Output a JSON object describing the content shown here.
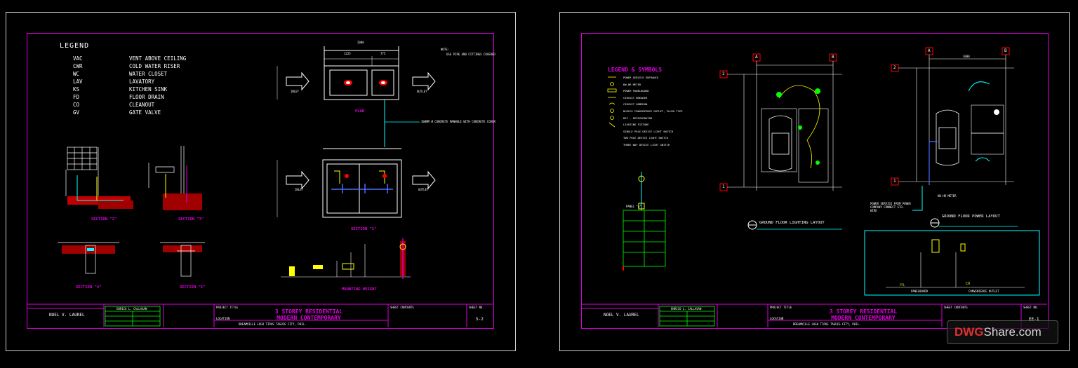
{
  "sheet_left": {
    "legend_title": "LEGEND",
    "legend": [
      {
        "code": "VAC",
        "desc": "VENT ABOVE CEILING"
      },
      {
        "code": "CWR",
        "desc": "COLD WATER RISER"
      },
      {
        "code": "WC",
        "desc": "WATER CLOSET"
      },
      {
        "code": "LAV",
        "desc": "LAVATORY"
      },
      {
        "code": "KS",
        "desc": "KITCHEN SINK"
      },
      {
        "code": "FD",
        "desc": "FLOOR DRAIN"
      },
      {
        "code": "CO",
        "desc": "CLEANOUT"
      },
      {
        "code": "GV",
        "desc": "GATE VALVE"
      }
    ],
    "labels": {
      "plan": "PLAN",
      "section_1": "SECTION \"1\"",
      "section_2": "SECTION \"2\"",
      "section_3": "SECTION \"3\"",
      "section_4": "SECTION \"4\"",
      "section_5": "SECTION \"5\"",
      "mounting_height": "MOUNTING HEIGHT",
      "inlet": "INLET",
      "outlet": "OUTLET",
      "dim_top": "2000",
      "dim_a": "1225",
      "dim_b": "775",
      "note": "USE PIPE AND FITTINGS COVERED",
      "note_head": "NOTE:",
      "manhole_note": "300MM Ø CONCRETE MANHOLE WITH CONCRETE COVER"
    },
    "title_block": {
      "designer": "NOEL V. LAUREL",
      "engineer": "ENRICO L. CALLASAN",
      "project_title_label": "PROJECT TITLE",
      "project_title": "3 STOREY RESIDENTIAL",
      "project_subtitle": "MODERN CONTEMPORARY",
      "location_label": "LOCATION",
      "location": "DREAMVILLE LUGO TIPAS TAGUIG CITY, PHIL.",
      "sheet_contents_label": "SHEET CONTENTS",
      "sheet_no_label": "SHEET NO.",
      "sheet_no": "S-2"
    }
  },
  "sheet_right": {
    "symbols_title": "LEGEND & SYMBOLS",
    "symbols": [
      "POWER SERVICE ENTRANCE",
      "KW-HR METER",
      "POWER PANELBOARD",
      "CIRCUIT BREAKER",
      "CIRCUIT HOMERUN",
      "DUPLEX CONVENIENCE OUTLET, FLUSH TYPE",
      "REF - REFRIGERATOR",
      "LIGHTING FIXTURE",
      "SINGLE POLE DEVICE LIGHT SWITCH",
      "TWO POLE DEVICE LIGHT SWITCH",
      "THREE WAY DEVICE LIGHT SWITCH"
    ],
    "panel_label": "PANEL \"A\"",
    "lighting_layout": "GROUND FLOOR LIGHTING LAYOUT",
    "power_layout": "GROUND FLOOR POWER LAYOUT",
    "grid_a": "A",
    "grid_b": "B",
    "grid_1": "1",
    "grid_2": "2",
    "dim_top": "3000",
    "kwhr_meter": "KW-HR METER",
    "power_note": "POWER SERVICE FROM POWER COMPANY CONNECT STO. WIRE",
    "fix_labels": {
      "ffl": "FFL",
      "co": "CO",
      "panelboard": "PANELBOARD",
      "outlet": "CONVENIENCE OUTLET"
    },
    "title_block": {
      "designer": "NOEL V. LAUREL",
      "engineer": "ENRICO L. CALLASAN",
      "project_title_label": "PROJECT TITLE",
      "project_title": "3 STOREY RESIDENTIAL",
      "project_subtitle": "MODERN CONTEMPORARY",
      "location_label": "LOCATION",
      "location": "DREAMVILLE LUGO TIPAS TAGUIG CITY, PHIL.",
      "sheet_contents_label": "SHEET CONTENTS",
      "sheet_no_label": "SHEET NO.",
      "sheet_no": "EE-1"
    }
  },
  "watermark": {
    "part1": "DWG",
    "part2": "Share",
    "part3": ".com"
  },
  "colors": {
    "magenta": "#e000e0",
    "yellow": "#ffff00",
    "green": "#00ff00",
    "cyan": "#00ffff",
    "red": "#ff0000",
    "blue": "#4a6cff"
  }
}
